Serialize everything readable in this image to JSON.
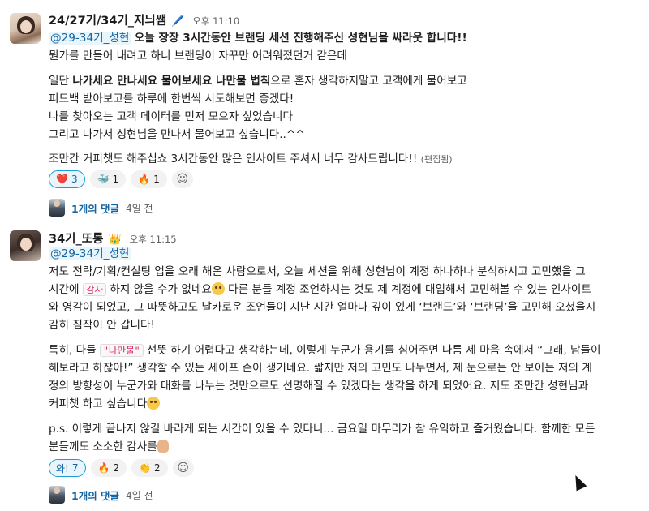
{
  "messages": [
    {
      "author": "24/27기/34기_지늬쌤",
      "author_badge": "pencil-icon",
      "time": "오후 11:10",
      "lines": {
        "l1_mention": "@29-34기_성현",
        "l1_rest": "오늘 장장 3시간동안 브랜딩 세션 진행해주신 성현님을 싸라웃 합니다!!",
        "l2": "뭔가를 만들어 내려고 하니 브랜딩이 자꾸만 어려워졌던거 같은데",
        "l3_pre": "일단 ",
        "l3_bold": "나가세요 만나세요 물어보세요 나만물 법칙",
        "l3_post": "으로 혼자 생각하지말고 고객에게 물어보고",
        "l4": "피드백 받아보고를 하루에 한번씩 시도해보면 좋겠다!",
        "l5": "나를 찾아오는 고객 데이터를 먼저 모으자 싶었습니다",
        "l6": "그리고 나가서 성현님을 만나서 물어보고 싶습니다..^^",
        "l7": "조만간 커피챗도 해주십쇼 3시간동안 많은 인사이트 주셔서 너무 감사드립니다!!",
        "edited": "(편집됨)"
      },
      "reactions": [
        {
          "icon": "❤️",
          "count": "3",
          "active": true
        },
        {
          "icon": "🐳",
          "count": "1",
          "active": false
        },
        {
          "icon": "🔥",
          "count": "1",
          "active": false
        }
      ],
      "thread": {
        "replies": "1개의 댓글",
        "when": "4일 전"
      }
    },
    {
      "author": "34기_또롱",
      "author_badge": "crown-icon",
      "time": "오후 11:15",
      "lines": {
        "l1_mention": "@29-34기_성현",
        "p1a": "저도 전략/기획/컨설팅 업을 오래 해온 사람으로서, 오늘 세션을 위해 성현님이 계정 하나하나 분석하시고 고민했을 그",
        "p1b_pre": "시간에 ",
        "p1b_code": "감사",
        "p1b_post": " 하지 않을 수가 없네요",
        "p1b_post2": " 다른 분들 계정 조언하시는 것도 제 계정에 대입해서 고민해볼 수 있는 인사이트",
        "p1c": "와 영감이 되었고, 그 따뜻하고도 날카로운 조언들이 지난 시간 얼마나 깊이 있게 ‘브랜드’와 ‘브랜딩’을 고민해 오셨을지",
        "p1d": "감히 짐작이 안 갑니다!",
        "p2a_pre": "특히, 다들 ",
        "p2a_code": "\"나만물\"",
        "p2a_post": " 선뜻 하기 어렵다고 생각하는데, 이렇게 누군가 용기를 심어주면 나름 제 마음 속에서 “그래, 남들이",
        "p2b": "해보라고 하잖아!” 생각할 수 있는 세이프 존이 생기네요. 짧지만 저의 고민도 나누면서, 제 눈으로는 안 보이는 저의 계",
        "p2c": "정의 방향성이 누군가와 대화를 나누는 것만으로도 선명해질 수 있겠다는 생각을 하게 되었어요. 저도 조만간 성현님과",
        "p2d": "커피챗 하고 싶습니다",
        "p3a": "p.s. 이렇게 끝나지 않길 바라게 되는 시간이 있을 수 있다니... 금요일 마무리가 참 유익하고 즐거웠습니다. 함께한 모든",
        "p3b": "분들께도 소소한 감사를"
      },
      "reactions": [
        {
          "icon": "와!",
          "count": "7",
          "active": true
        },
        {
          "icon": "🔥",
          "count": "2",
          "active": false
        },
        {
          "icon": "👏",
          "count": "2",
          "active": false
        }
      ],
      "thread": {
        "replies": "1개의 댓글",
        "when": "4일 전"
      }
    }
  ],
  "icons": {
    "add_reaction": "add-reaction-icon",
    "sweat": "sweat-smile-emoji",
    "smile": "smile-emoji",
    "pray": "pray-emoji"
  }
}
